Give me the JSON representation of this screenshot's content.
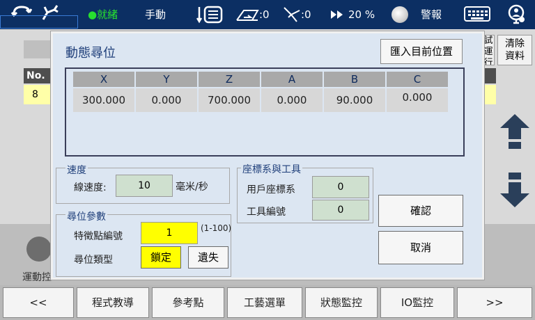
{
  "topbar": {
    "status": "●就緒",
    "mode": "手動",
    "coord_value": ":0",
    "tool_value": ":0",
    "speed": "20 %",
    "alarm": "警報"
  },
  "background": {
    "no_header": "No.",
    "row_no": "8",
    "side_button": "試運行",
    "clear_button_line1": "清除",
    "clear_button_line2": "資料",
    "move_label": "運動控"
  },
  "dialog": {
    "title": "動態尋位",
    "import_button": "匯入目前位置",
    "position": {
      "headers": [
        "X",
        "Y",
        "Z",
        "A",
        "B",
        "C"
      ],
      "values": [
        "300.000",
        "0.000",
        "700.000",
        "0.000",
        "90.000",
        "0.000"
      ]
    },
    "speed_group": {
      "label": "速度",
      "line_speed_label": "線速度:",
      "line_speed_value": "10",
      "unit": "毫米/秒"
    },
    "coord_group": {
      "label": "座標系與工具",
      "user_coord_label": "用戶座標系",
      "user_coord_value": "0",
      "tool_label": "工具編號",
      "tool_value": "0"
    },
    "search_group": {
      "label": "尋位參數",
      "feature_label": "特徵點編號",
      "feature_value": "1",
      "feature_range": "(1-100)",
      "type_label": "尋位類型",
      "lock_button": "鎖定",
      "lost_button": "遺失"
    },
    "confirm_button": "確認",
    "cancel_button": "取消"
  },
  "nav": {
    "prev": "<<",
    "items": [
      "程式教導",
      "參考點",
      "工藝選單",
      "狀態監控",
      "IO監控"
    ],
    "next": ">>"
  },
  "colors": {
    "topbar_bg": "#0c2f63",
    "status_green": "#27e02f",
    "dialog_bg": "#dce6f2",
    "highlight_yellow": "#ffff00"
  }
}
